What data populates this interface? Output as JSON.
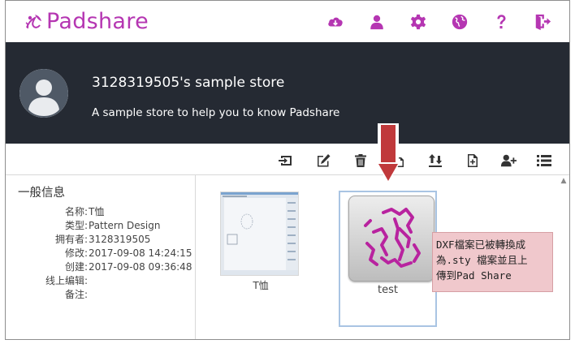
{
  "header": {
    "logo_text": "Padshare",
    "icons": [
      "cloud-download-icon",
      "user-icon",
      "gear-icon",
      "globe-icon",
      "help-icon",
      "logout-icon"
    ],
    "brand_color": "#b536b2"
  },
  "banner": {
    "store_name": "3128319505's sample store",
    "store_desc": "A sample store to help you to know Padshare",
    "background": "#252a33"
  },
  "toolbar": {
    "icons": [
      "move-to-icon",
      "edit-icon",
      "trash-icon",
      "copy-icon",
      "upload-download-icon",
      "new-file-icon",
      "add-user-icon",
      "list-icon"
    ]
  },
  "info": {
    "title": "一般信息",
    "rows": [
      {
        "key": "名称:",
        "value": "T恤"
      },
      {
        "key": "类型:",
        "value": "Pattern Design"
      },
      {
        "key": "拥有者:",
        "value": "3128319505"
      },
      {
        "key": "修改:",
        "value": "2017-09-08 14:24:15"
      },
      {
        "key": "创建:",
        "value": "2017-09-08 09:36:48"
      },
      {
        "key": "线上编辑:",
        "value": ""
      },
      {
        "key": "备注:",
        "value": ""
      }
    ]
  },
  "files": [
    {
      "label": "T恤",
      "selected": false
    },
    {
      "label": "test",
      "selected": true
    }
  ],
  "annotation": {
    "text_line1": "DXF檔案已被轉換成",
    "text_line2": "為.sty 檔案並且上",
    "text_line3": "傳到Pad Share",
    "arrow_color": "#c0393b"
  }
}
